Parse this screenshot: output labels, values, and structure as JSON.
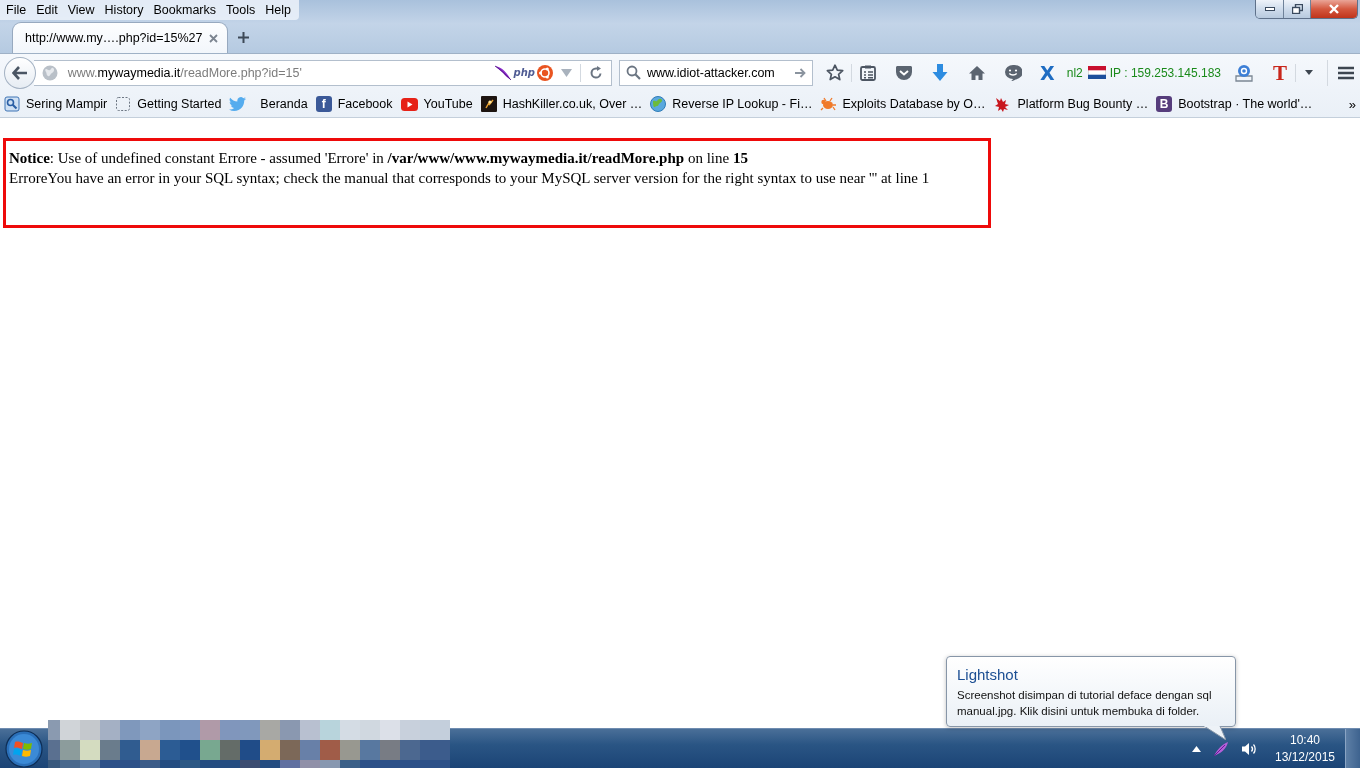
{
  "menu_bar": {
    "items": [
      "File",
      "Edit",
      "View",
      "History",
      "Bookmarks",
      "Tools",
      "Help"
    ]
  },
  "tabs": [
    {
      "title": "http://www.my….php?id=15%27",
      "selected": true
    }
  ],
  "nav_bar": {
    "url": {
      "subdomain": "www.",
      "domain": "mywaymedia.it",
      "path": "/readMore.php?id=15'"
    },
    "php_badge": "php",
    "search": {
      "value": "www.idiot-attacker.com"
    },
    "x_button": "X",
    "proxy_region": "nl2",
    "ip": "IP : 159.253.145.183",
    "t_button": "T"
  },
  "bookmarks": {
    "items": [
      {
        "label": "Sering Mampir",
        "kind": "search-page"
      },
      {
        "label": "Getting Started",
        "kind": "dashed-square"
      },
      {
        "label": "Beranda",
        "kind": "bird"
      },
      {
        "label": "Facebook",
        "kind": "letter",
        "letter": "f",
        "color": "#3b5998"
      },
      {
        "label": "YouTube",
        "kind": "play-button"
      },
      {
        "label": "HashKiller.co.uk, Over …",
        "kind": "dark-square"
      },
      {
        "label": "Reverse IP Lookup - Fi…",
        "kind": "globe"
      },
      {
        "label": "Exploits Database by O…",
        "kind": "bug"
      },
      {
        "label": "Platform Bug Bounty …",
        "kind": "splat"
      },
      {
        "label": "Bootstrap · The world'…",
        "kind": "letter",
        "letter": "B",
        "color": "#563d7c"
      }
    ],
    "overflow": "»"
  },
  "page": {
    "notice": "**Notice**: Use of undefined constant Errore - assumed 'Errore' in **/var/www/www.mywaymedia.it/readMore.php** on line **15**",
    "error": "ErroreYou have an error in your SQL syntax; check the manual that corresponds to your MySQL server version for the right syntax to use near ''' at line 1"
  },
  "notification": {
    "title": "Lightshot",
    "text": "Screenshot disimpan di tutorial deface dengan sql manual.jpg. Klik disini untuk membuka di folder."
  },
  "taskbar": {
    "time": "10:40",
    "date": "13/12/2015"
  }
}
